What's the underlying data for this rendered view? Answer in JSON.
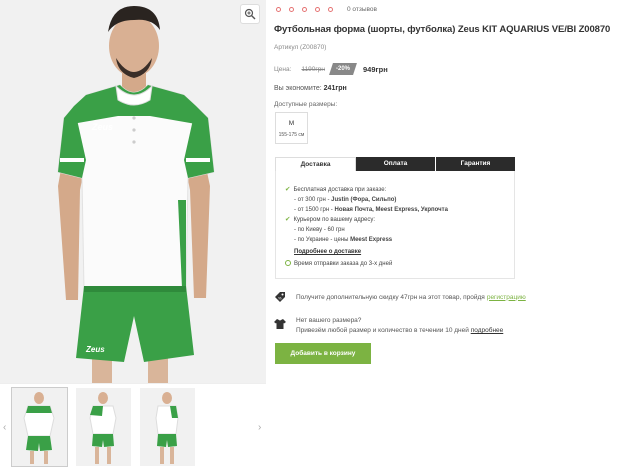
{
  "product": {
    "title": "Футбольная форма (шорты, футболка) Zeus KIT AQUARIUS VE/BI Z00870",
    "reviews": "0 отзывов",
    "sku": "Артикул (Z00870)",
    "price_label": "Цена:",
    "old_price": "1190грн",
    "discount": "-20%",
    "new_price": "949грн",
    "save_label": "Вы экономите:",
    "save_value": "241грн",
    "sizes_label": "Доступные размеры:",
    "sizes": [
      {
        "size": "M",
        "height": "155-175 см"
      }
    ]
  },
  "tabs": [
    "Доставка",
    "Оплата",
    "Гарантия"
  ],
  "delivery": {
    "free_title": "Бесплатная доставка при заказе:",
    "line1_prefix": "- от 300 грн - ",
    "line1_bold": "Justin (Фора, Сильпо)",
    "line2_prefix": "- от 1500 грн - ",
    "line2_bold": "Новая Почта, Meest Express, Укрпочта",
    "courier_title": "Курьером по вашему адресу:",
    "courier_kiev": "- по Киеву - 60 грн",
    "courier_ua_prefix": "- по Украине - цены ",
    "courier_ua_bold": "Meest Express",
    "more_link": "Подробнее о доставке",
    "ship_time": "Время отправки заказа до 3-х дней"
  },
  "promo": {
    "text": "Получите дополнительную скидку 47грн на этот товар, пройдя ",
    "link": "регистрацию"
  },
  "size_help": {
    "line1": "Нет вашего размера?",
    "line2": "Привезём любой размер и количество в течении 10 дней ",
    "link": "подробнее"
  },
  "buy_button": "Добавить в корзину",
  "shirt_logo": "Zeus",
  "icons": {
    "zoom": "zoom-icon",
    "check": "check-icon",
    "clock": "clock-icon",
    "discount": "discount-tag-icon",
    "size": "tshirt-icon",
    "prev": "chevron-left-icon",
    "next": "chevron-right-icon"
  },
  "colors": {
    "accent": "#7cb342",
    "dark_tab": "#2b2b2b",
    "jersey_green": "#3aa047",
    "rating": "#e57373"
  }
}
